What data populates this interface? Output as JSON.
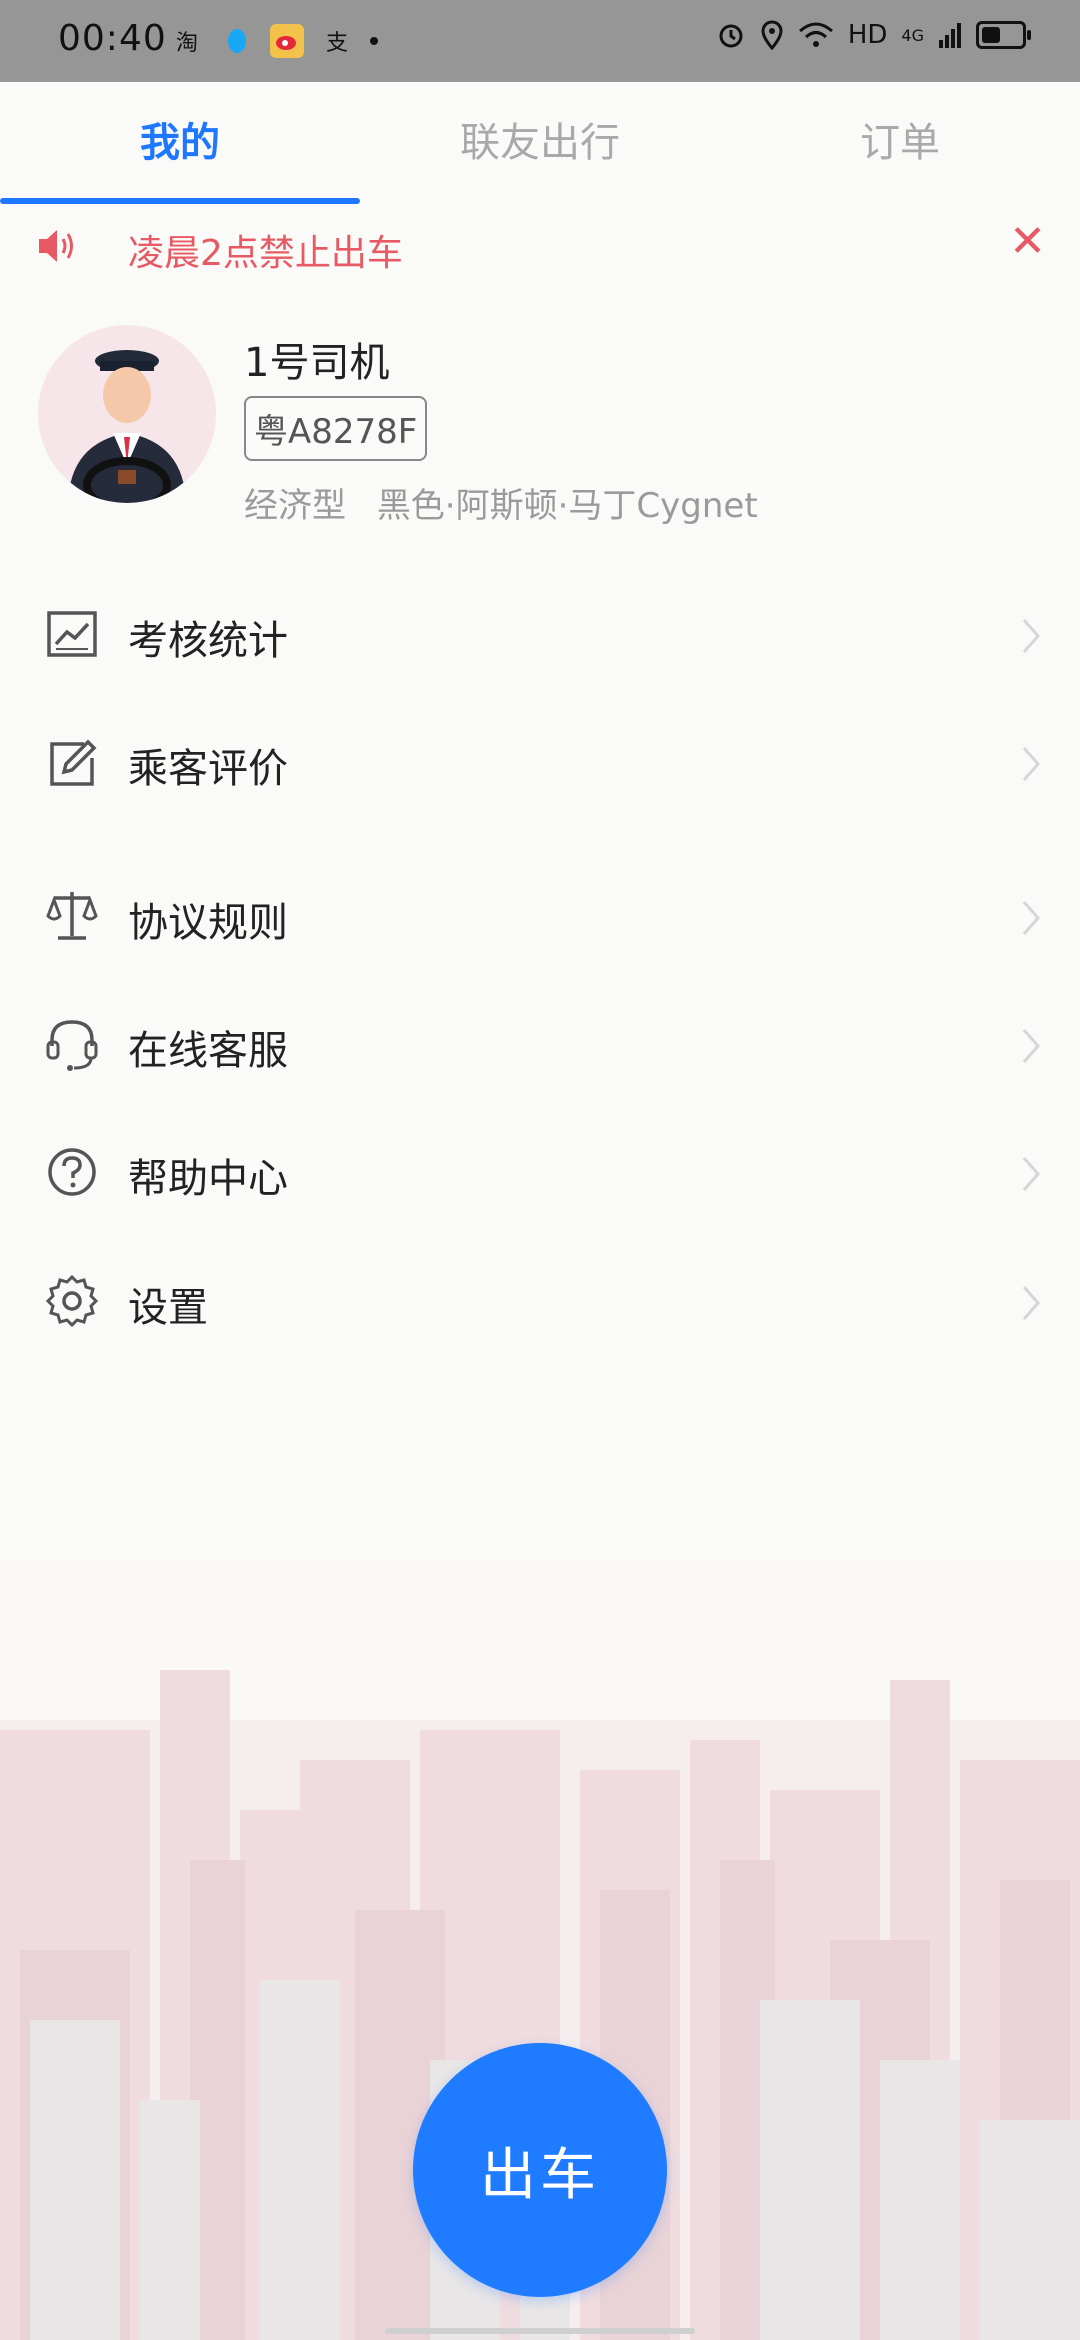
{
  "status_bar": {
    "time": "00:40",
    "notif_taobao": "淘",
    "notif_alipay": "支",
    "signal_label": "HD",
    "network": "4G"
  },
  "tabs": [
    {
      "label": "我的",
      "active": true
    },
    {
      "label": "联友出行",
      "active": false
    },
    {
      "label": "订单",
      "active": false
    }
  ],
  "notice": {
    "text": "凌晨2点禁止出车",
    "close": "✕"
  },
  "profile": {
    "name": "1号司机",
    "plate": "粤A8278F",
    "car_type": "经济型",
    "car_model": "黑色·阿斯顿·马丁Cygnet"
  },
  "menu": [
    {
      "label": "考核统计",
      "icon": "chart-icon"
    },
    {
      "label": "乘客评价",
      "icon": "edit-icon"
    },
    {
      "label": "协议规则",
      "icon": "scale-icon"
    },
    {
      "label": "在线客服",
      "icon": "headset-icon"
    },
    {
      "label": "帮助中心",
      "icon": "help-icon"
    },
    {
      "label": "设置",
      "icon": "gear-icon"
    }
  ],
  "go_button": "出车",
  "colors": {
    "accent": "#1e78ff",
    "warning": "#e85a63"
  }
}
